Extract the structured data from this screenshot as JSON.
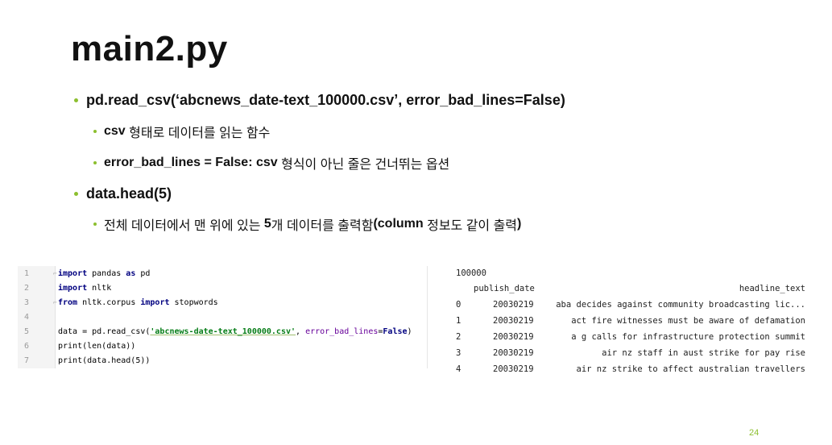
{
  "slide": {
    "title": "main2.py",
    "bullet1": {
      "text": "pd.read_csv(‘abcnews_date-text_100000.csv’, error_bad_lines=False)",
      "sub1_pre": "csv",
      "sub1_rest": " 형태로 데이터를 읽는 함수",
      "sub2_pre": "error_bad_lines = False: csv",
      "sub2_rest": " 형식이 아닌 줄은 건너뛰는 옵션"
    },
    "bullet2": {
      "text": "data.head(5)",
      "sub1_a": "전체 데이터에서 맨 위에 있는 ",
      "sub1_b": "5",
      "sub1_c": "개 데이터를 출력함",
      "sub1_d": "(column",
      "sub1_e": " 정보도 같이 출력",
      "sub1_f": ")"
    },
    "page_number": "24"
  },
  "code": {
    "line_numbers": [
      "1",
      "2",
      "3",
      "4",
      "5",
      "6",
      "7"
    ],
    "l1": {
      "kw1": "import",
      "mid": " pandas ",
      "kw2": "as",
      "end": " pd"
    },
    "l2": {
      "kw1": "import",
      "end": " nltk"
    },
    "l3": {
      "kw1": "from",
      "mid": " nltk.corpus ",
      "kw2": "import",
      "end": " stopwords"
    },
    "l5": {
      "a": "data = pd.read_csv(",
      "str": "'abcnews-date-text_100000.csv'",
      "b": ", ",
      "prm": "error_bad_lines",
      "c": "=",
      "bool": "False",
      "d": ")"
    },
    "l6": "print(len(data))",
    "l7": "print(data.head(5))"
  },
  "output": {
    "count": "100000",
    "headers": [
      "publish_date",
      "headline_text"
    ],
    "rows": [
      {
        "idx": "0",
        "date": "20030219",
        "text": "aba decides against community broadcasting lic..."
      },
      {
        "idx": "1",
        "date": "20030219",
        "text": "act fire witnesses must be aware of defamation"
      },
      {
        "idx": "2",
        "date": "20030219",
        "text": "a g calls for infrastructure protection summit"
      },
      {
        "idx": "3",
        "date": "20030219",
        "text": "air nz staff in aust strike for pay rise"
      },
      {
        "idx": "4",
        "date": "20030219",
        "text": "air nz strike to affect australian travellers"
      }
    ]
  }
}
